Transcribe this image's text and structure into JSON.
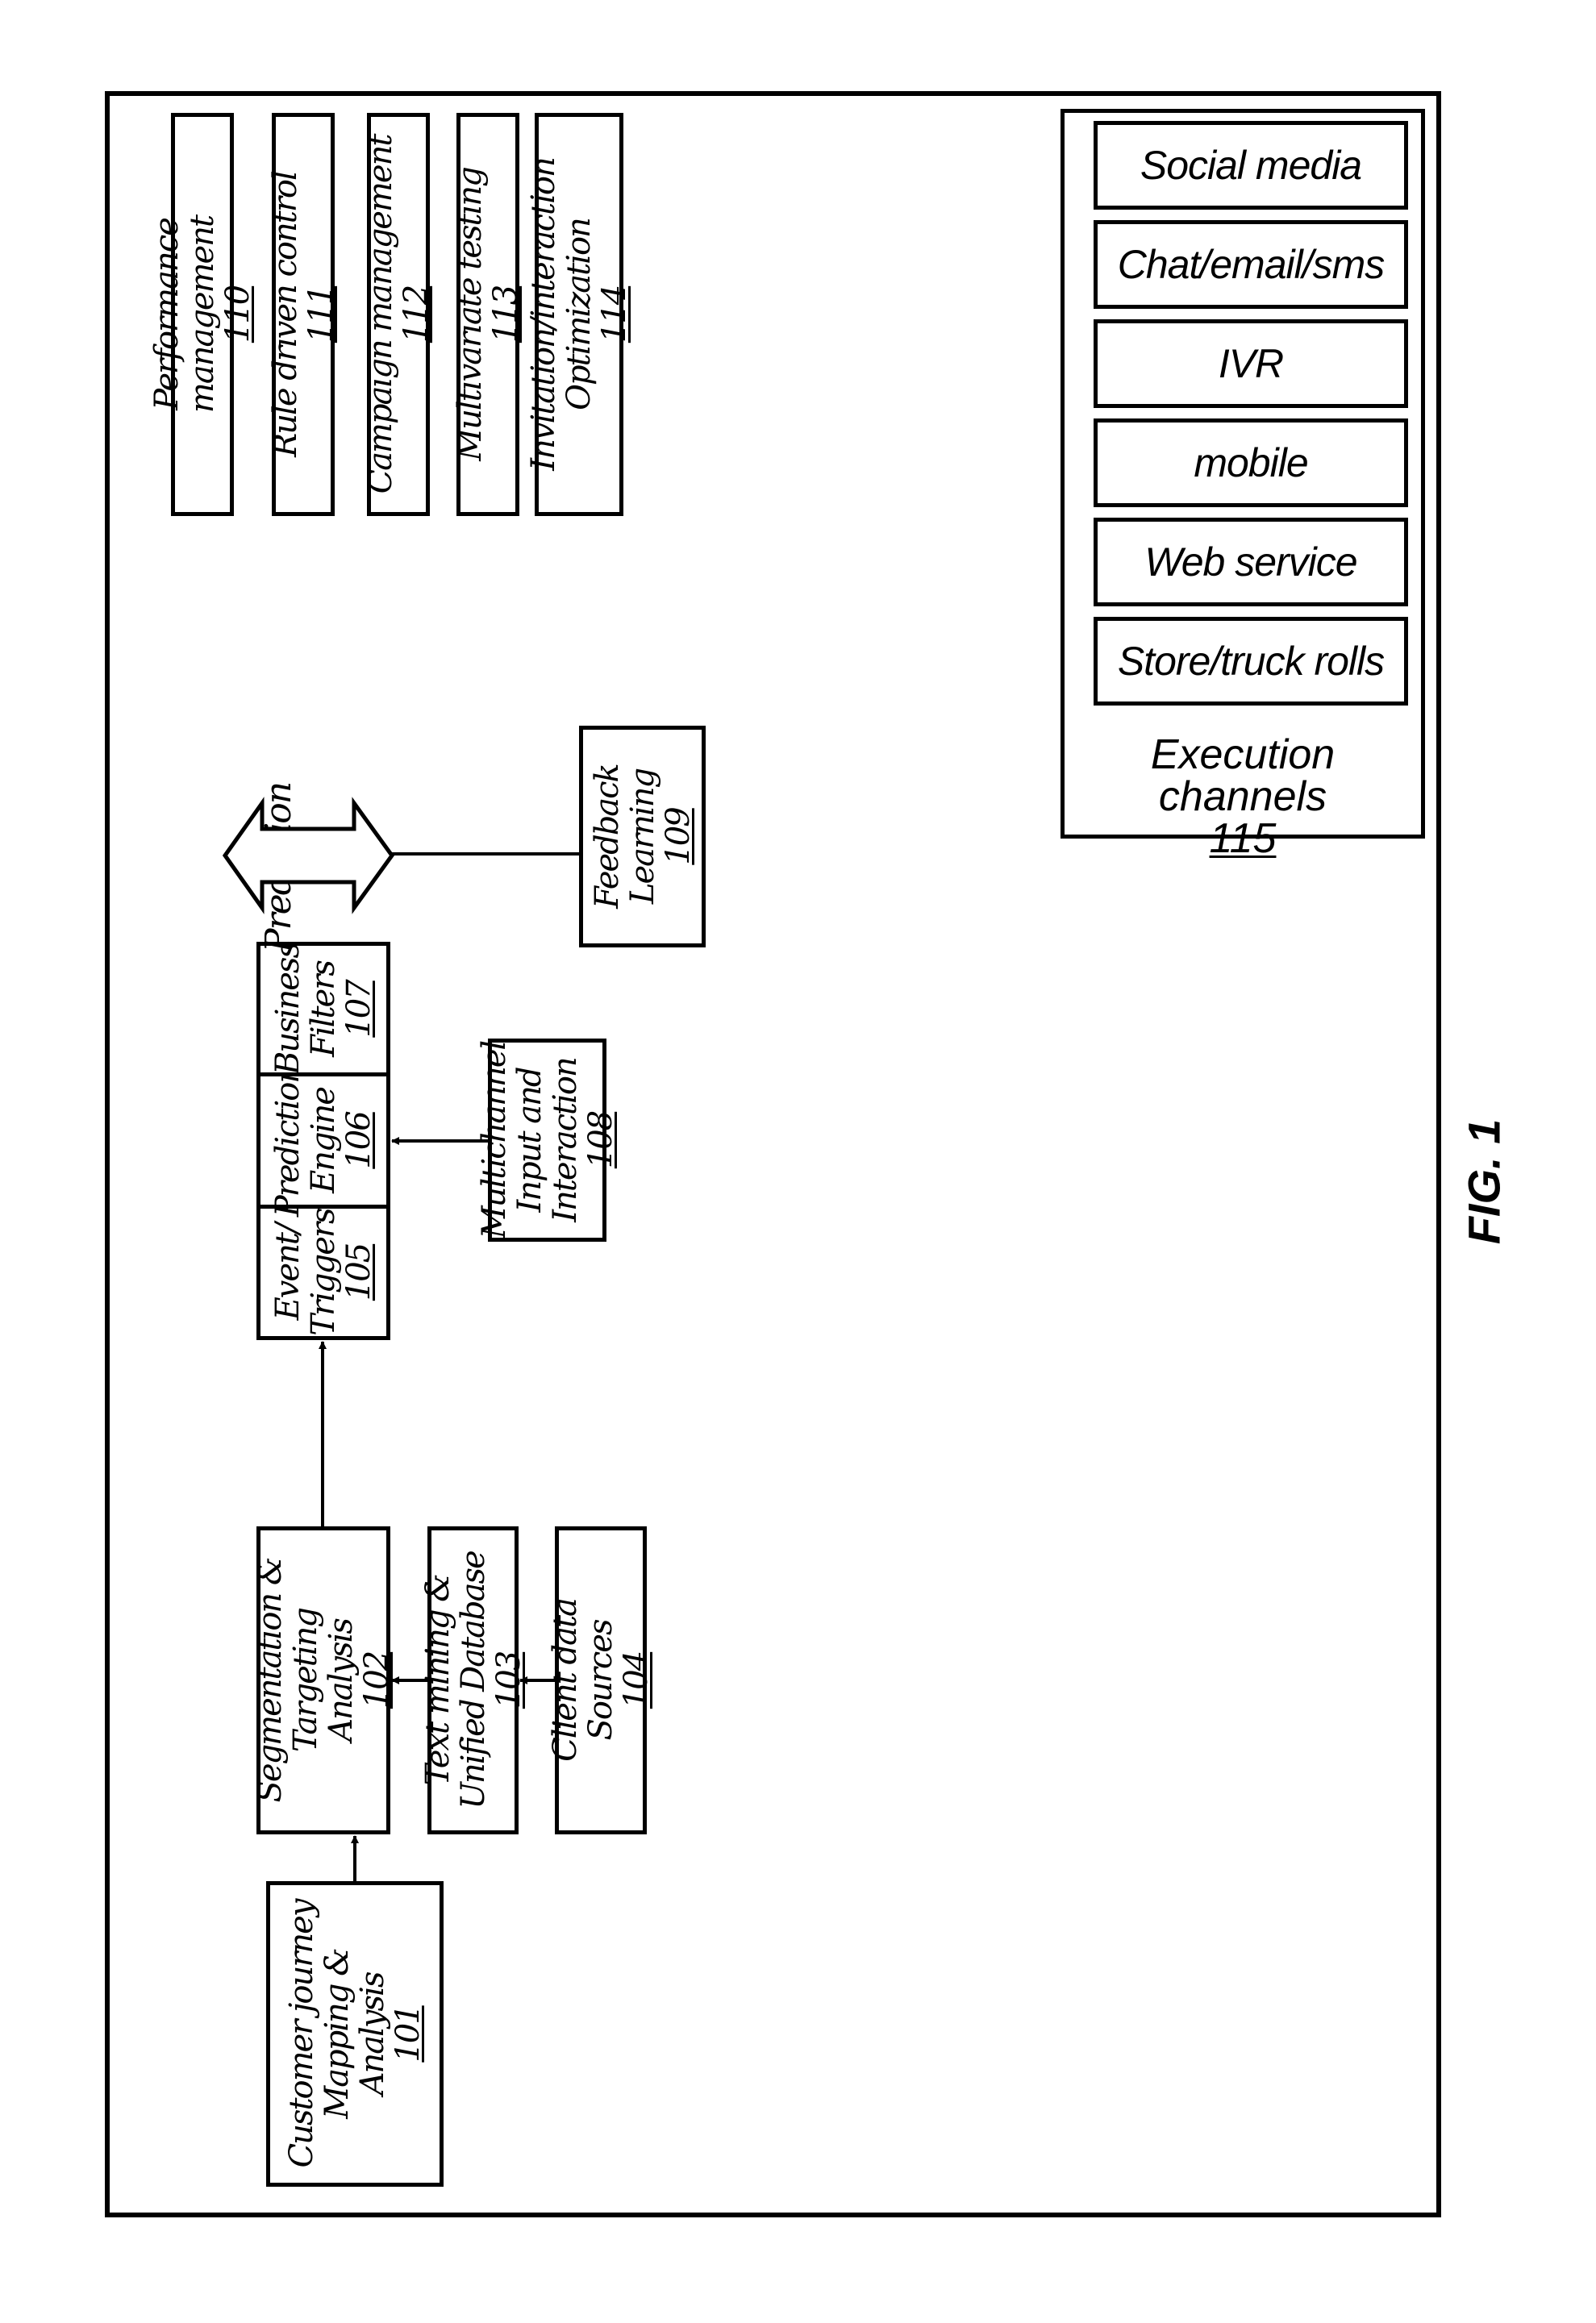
{
  "figure_label": "FIG. 1",
  "blocks": {
    "b101": {
      "lines": [
        "Customer journey",
        "Mapping &",
        "Analysis"
      ],
      "ref": "101"
    },
    "b102": {
      "lines": [
        "Segmentation &",
        "Targeting",
        "Analysis"
      ],
      "ref": "102"
    },
    "b103": {
      "lines": [
        "Text mining &",
        "Unified Database"
      ],
      "ref": "103"
    },
    "b104": {
      "lines": [
        "Client data",
        "Sources"
      ],
      "ref": "104"
    },
    "b105": {
      "lines": [
        "Event/",
        "Triggers"
      ],
      "ref": "105"
    },
    "b106": {
      "lines": [
        "Prediction",
        "Engine"
      ],
      "ref": "106"
    },
    "b107": {
      "lines": [
        "Business",
        "Filters"
      ],
      "ref": "107"
    },
    "b108": {
      "lines": [
        "Multichannel",
        "Input and",
        "Interaction"
      ],
      "ref": "108"
    },
    "b109": {
      "lines": [
        "Feedback",
        "Learning"
      ],
      "ref": "109"
    },
    "b110": {
      "lines": [
        "Performance management"
      ],
      "ref": "110"
    },
    "b111": {
      "lines": [
        "Rule driven control"
      ],
      "ref": "111"
    },
    "b112": {
      "lines": [
        "Campaign management"
      ],
      "ref": "112"
    },
    "b113": {
      "lines": [
        "Multivariate testing"
      ],
      "ref": "113"
    },
    "b114": {
      "lines": [
        "Invitation/interaction",
        "Optimization"
      ],
      "ref": "114"
    }
  },
  "prediction_arrow_label": "Prediction",
  "execution_channels": {
    "title": "Execution channels",
    "ref": "115",
    "channels": [
      "Social media",
      "Chat/email/sms",
      "IVR",
      "mobile",
      "Web service",
      "Store/truck rolls"
    ]
  },
  "connections": [
    {
      "from": "101",
      "to": "102"
    },
    {
      "from": "102",
      "to": "105"
    },
    {
      "from": "103",
      "to": "102"
    },
    {
      "from": "104",
      "to": "103"
    },
    {
      "from": "108",
      "to": "106"
    },
    {
      "from": "109",
      "to": "prediction-arrow"
    },
    {
      "from": "107",
      "to": "execution",
      "label": "Prediction",
      "bidirectional": true
    }
  ]
}
